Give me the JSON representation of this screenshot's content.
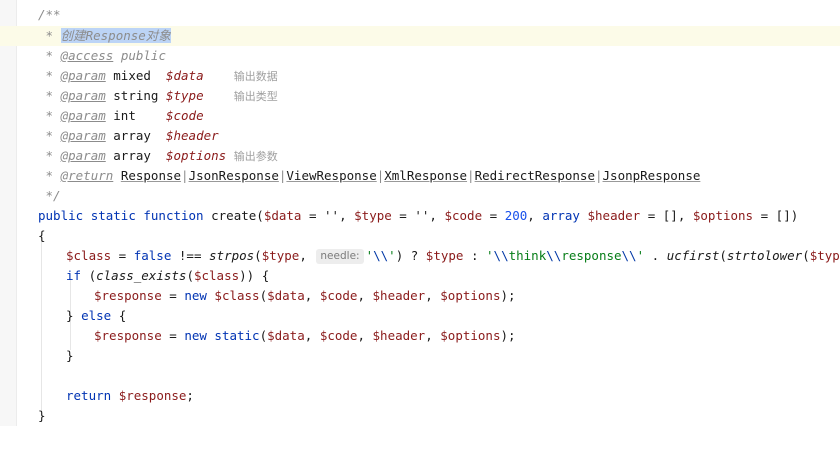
{
  "doc": {
    "open": "/**",
    "star": "*",
    "summary": "创建Response对象",
    "access_tag": "@access",
    "access_value": "public",
    "param_tag": "@param",
    "return_tag": "@return",
    "params": [
      {
        "type": "mixed",
        "gap1": "  ",
        "var": "$data",
        "gap2": "    ",
        "desc": "输出数据"
      },
      {
        "type": "string",
        "gap1": " ",
        "var": "$type",
        "gap2": "    ",
        "desc": "输出类型"
      },
      {
        "type": "int",
        "gap1": "    ",
        "var": "$code",
        "gap2": "",
        "desc": ""
      },
      {
        "type": "array",
        "gap1": "  ",
        "var": "$header",
        "gap2": "",
        "desc": ""
      },
      {
        "type": "array",
        "gap1": "  ",
        "var": "$options",
        "gap2": " ",
        "desc": "输出参数"
      }
    ],
    "return_types": [
      "Response",
      "JsonResponse",
      "ViewResponse",
      "XmlResponse",
      "RedirectResponse",
      "JsonpResponse"
    ],
    "separator": "|",
    "close": "*/"
  },
  "code": {
    "kw_public": "public",
    "kw_static": "static",
    "kw_function": "function",
    "fn_name": "create",
    "sig": {
      "open": "(",
      "v_data": "$data",
      "eq_empty": " = '', ",
      "v_type": "$type",
      "eq_empty2": " = '', ",
      "v_code": "$code",
      "eq": " = ",
      "code_default": "200",
      "comma": ", ",
      "kw_array": "array",
      "v_header": "$header",
      "eq_arr": " = [], ",
      "v_options": "$options",
      "eq_arr_end": " = [])"
    },
    "brace_open": "{",
    "brace_close": "}",
    "l1": {
      "v_class": "$class",
      "eq": " = ",
      "kw_false": "false",
      "op_nid": " !== ",
      "fn_strpos": "strpos",
      "p_open": "(",
      "v_type": "$type",
      "comma": ", ",
      "hint": "needle:",
      "s_open": "'",
      "esc_bs": "\\\\",
      "s_close": "'",
      "tern": ") ? ",
      "v_type2": "$type",
      "colon": " : ",
      "s2_open": "'",
      "esc1": "\\\\",
      "word1": "think",
      "esc2": "\\\\",
      "word2": "response",
      "esc3": "\\\\",
      "s2_close": "'",
      "dot": " . ",
      "fn_ucfirst": "ucfirst",
      "p2": "(",
      "fn_lower": "strtolower",
      "p3": "(",
      "v_type3": "$type",
      "end": "));"
    },
    "l2": {
      "kw_if": "if",
      "open": " (",
      "fn": "class_exists",
      "p": "(",
      "v": "$class",
      "end": ")) {"
    },
    "l3": {
      "v_resp": "$response",
      "eq": " = ",
      "kw_new": "new",
      "sp": " ",
      "v_class": "$class",
      "args": "(",
      "a1": "$data",
      "c1": ", ",
      "a2": "$code",
      "c2": ", ",
      "a3": "$header",
      "c3": ", ",
      "a4": "$options",
      "end": ");"
    },
    "l4": {
      "close": "} ",
      "kw_else": "else",
      "open": " {"
    },
    "l5": {
      "v_resp": "$response",
      "eq": " = ",
      "kw_new": "new",
      "kw_static": "static",
      "args": "(",
      "a1": "$data",
      "c1": ", ",
      "a2": "$code",
      "c2": ", ",
      "a3": "$header",
      "c3": ", ",
      "a4": "$options",
      "end": ");"
    },
    "l6": {
      "close": "}"
    },
    "l7": {
      "kw_return": "return",
      "v_resp": "$response",
      "end": ";"
    }
  },
  "colors": {
    "keyword": "#0033b3",
    "variable": "#8a1a1a",
    "string": "#067d17",
    "number": "#1750eb",
    "comment": "#8c8c8c",
    "selection": "#bcd4f6",
    "current_line": "#fcfbe8"
  }
}
